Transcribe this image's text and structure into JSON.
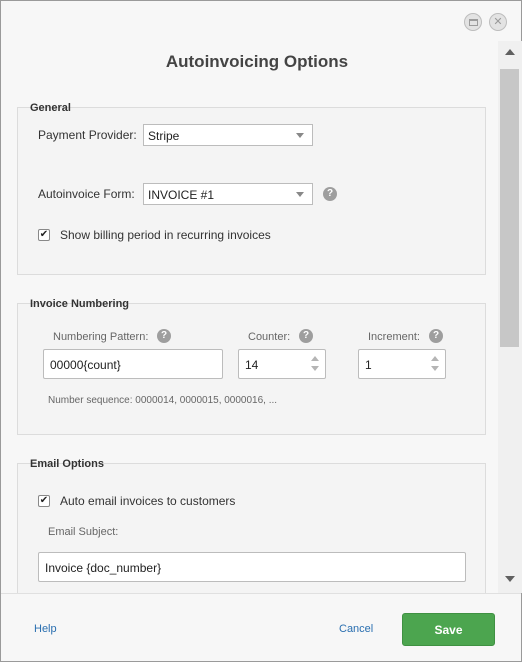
{
  "dialog": {
    "title": "Autoinvoicing Options"
  },
  "general": {
    "title": "General",
    "payment_provider_label": "Payment Provider:",
    "payment_provider_value": "Stripe",
    "autoinvoice_form_label": "Autoinvoice Form:",
    "autoinvoice_form_value": "INVOICE #1",
    "show_billing_label": "Show billing period in recurring invoices",
    "show_billing_checked": true
  },
  "invoice_numbering": {
    "title": "Invoice Numbering",
    "pattern_label": "Numbering Pattern:",
    "pattern_value": "00000{count}",
    "counter_label": "Counter:",
    "counter_value": "14",
    "increment_label": "Increment:",
    "increment_value": "1",
    "sequence_text": "Number sequence: 0000014, 0000015, 0000016, ..."
  },
  "email_options": {
    "title": "Email Options",
    "auto_email_label": "Auto email invoices to customers",
    "auto_email_checked": true,
    "subject_label": "Email Subject:",
    "subject_value": "Invoice {doc_number}"
  },
  "footer": {
    "help_label": "Help",
    "cancel_label": "Cancel",
    "save_label": "Save"
  },
  "colors": {
    "save_button": "#4ca54f",
    "link": "#2a6fb0"
  }
}
